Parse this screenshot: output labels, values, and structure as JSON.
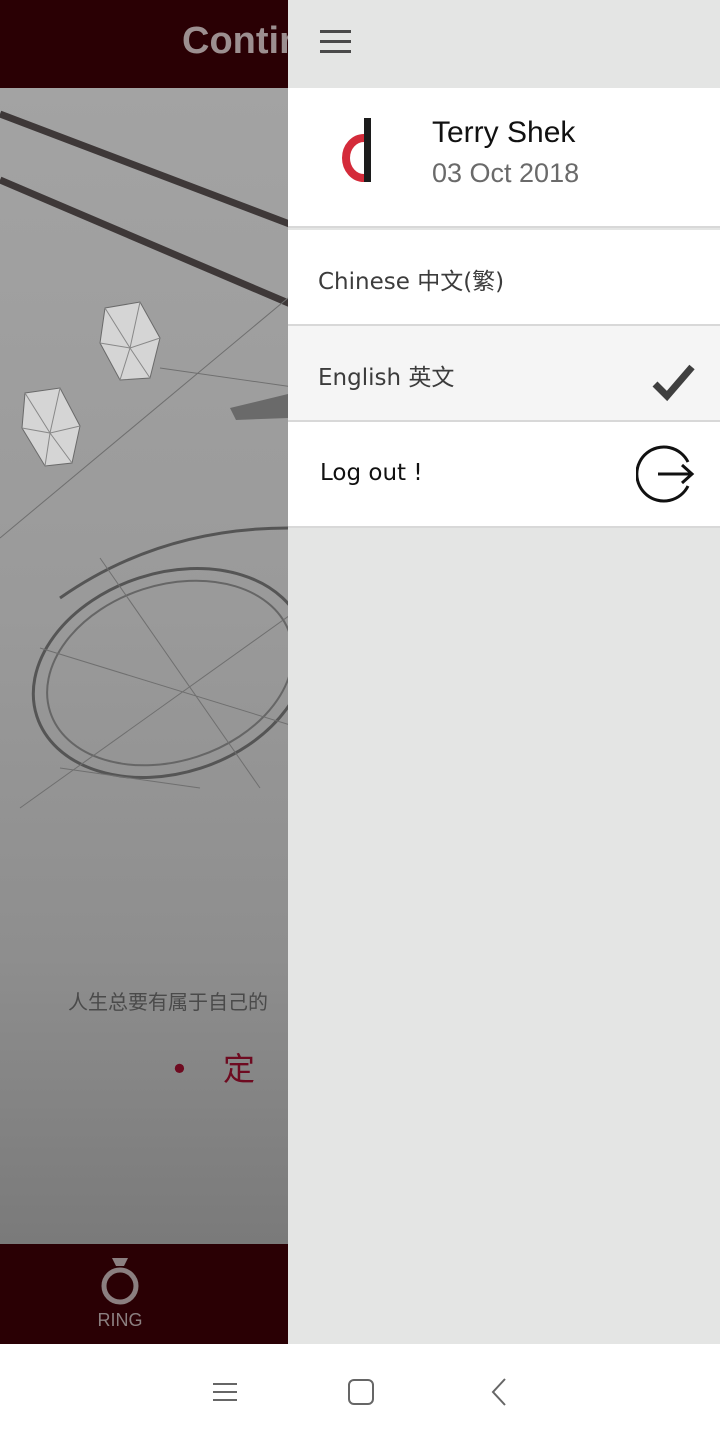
{
  "background": {
    "header_title": "Contin",
    "slogan": "人生总要有属于自己的",
    "custom_text": "• 定 制 珏",
    "footer_tab_label": "RING",
    "header_color": "#2a0004"
  },
  "drawer": {
    "menu_icon": "hamburger-icon",
    "user": {
      "name": "Terry Shek",
      "date": "03 Oct 2018",
      "logo_icon": "brand-logo-d"
    },
    "items": [
      {
        "label": "Chinese 中文(繁)",
        "selected": false
      },
      {
        "label": "English 英文",
        "selected": true,
        "icon": "checkmark-icon"
      },
      {
        "label": "Log out !",
        "icon": "logout-icon"
      }
    ]
  },
  "system_nav": {
    "buttons": [
      "menu-icon",
      "home-icon",
      "back-icon"
    ]
  },
  "colors": {
    "accent": "#d42b3a",
    "drawer_bg": "#e4e5e4",
    "selected_row": "#f5f5f5"
  }
}
